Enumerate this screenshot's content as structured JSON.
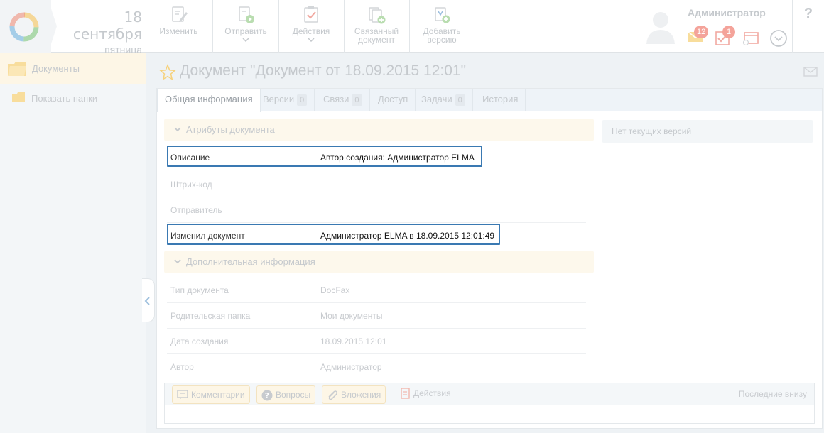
{
  "header": {
    "date_day": "18 сентября",
    "date_weekday": "пятница",
    "toolbar": [
      {
        "label": "Изменить",
        "icon": "edit-document-icon",
        "has_dropdown": false
      },
      {
        "label": "Отправить",
        "icon": "send-document-icon",
        "has_dropdown": true
      },
      {
        "label": "Действия",
        "icon": "actions-checklist-icon",
        "has_dropdown": true
      },
      {
        "label": "Связанный документ",
        "label_lines": [
          "Связанный",
          "документ"
        ],
        "icon": "linked-document-icon",
        "has_dropdown": false
      },
      {
        "label": "Добавить версию",
        "label_lines": [
          "Добавить",
          "версию"
        ],
        "icon": "add-version-icon",
        "has_dropdown": false
      }
    ],
    "user_name": "Администратор",
    "messages_count": "12",
    "tasks_count": "1",
    "help_label": "?"
  },
  "sidebar": {
    "items": [
      {
        "label": "Документы",
        "icon": "folder-open-icon",
        "active": true
      },
      {
        "label": "Показать папки",
        "icon": "folder-icon",
        "active": false
      }
    ]
  },
  "main": {
    "title": "Документ \"Документ от 18.09.2015 12:01\"",
    "tabs": [
      {
        "label": "Общая информация",
        "count": null,
        "active": true
      },
      {
        "label": "Версии",
        "count": "0",
        "active": false
      },
      {
        "label": "Связи",
        "count": "0",
        "active": false
      },
      {
        "label": "Доступ",
        "count": null,
        "active": false
      },
      {
        "label": "Задачи",
        "count": "0",
        "active": false
      },
      {
        "label": "История",
        "count": null,
        "active": false
      }
    ],
    "attributes_section": {
      "title": "Атрибуты документа",
      "rows": [
        {
          "key": "Описание",
          "value": "Автор создания: Администратор ELMA",
          "highlighted": true
        },
        {
          "key": "Штрих-код",
          "value": "",
          "highlighted": false
        },
        {
          "key": "Отправитель",
          "value": "",
          "highlighted": false
        },
        {
          "key": "Изменил документ",
          "value": "Администратор ELMA в 18.09.2015 12:01:49",
          "highlighted": true
        }
      ]
    },
    "extra_section": {
      "title": "Дополнительная информация",
      "rows": [
        {
          "key": "Тип документа",
          "value": "DocFax"
        },
        {
          "key": "Родительская папка",
          "value": "Мои документы"
        },
        {
          "key": "Дата создания",
          "value": "18.09.2015 12:01"
        },
        {
          "key": "Автор",
          "value": "Администратор"
        }
      ]
    },
    "versions_empty": "Нет текущих версий",
    "comments_bar": {
      "comments_label": "Комментарии",
      "questions_label": "Вопросы",
      "attachments_label": "Вложения",
      "actions_label": "Действия",
      "order_label": "Последние внизу"
    }
  },
  "colors": {
    "highlight_border": "#3a79b2",
    "faded_text": "#c5c9cd",
    "section_bg": "#fdf8ec",
    "badge": "#f4a39a"
  }
}
